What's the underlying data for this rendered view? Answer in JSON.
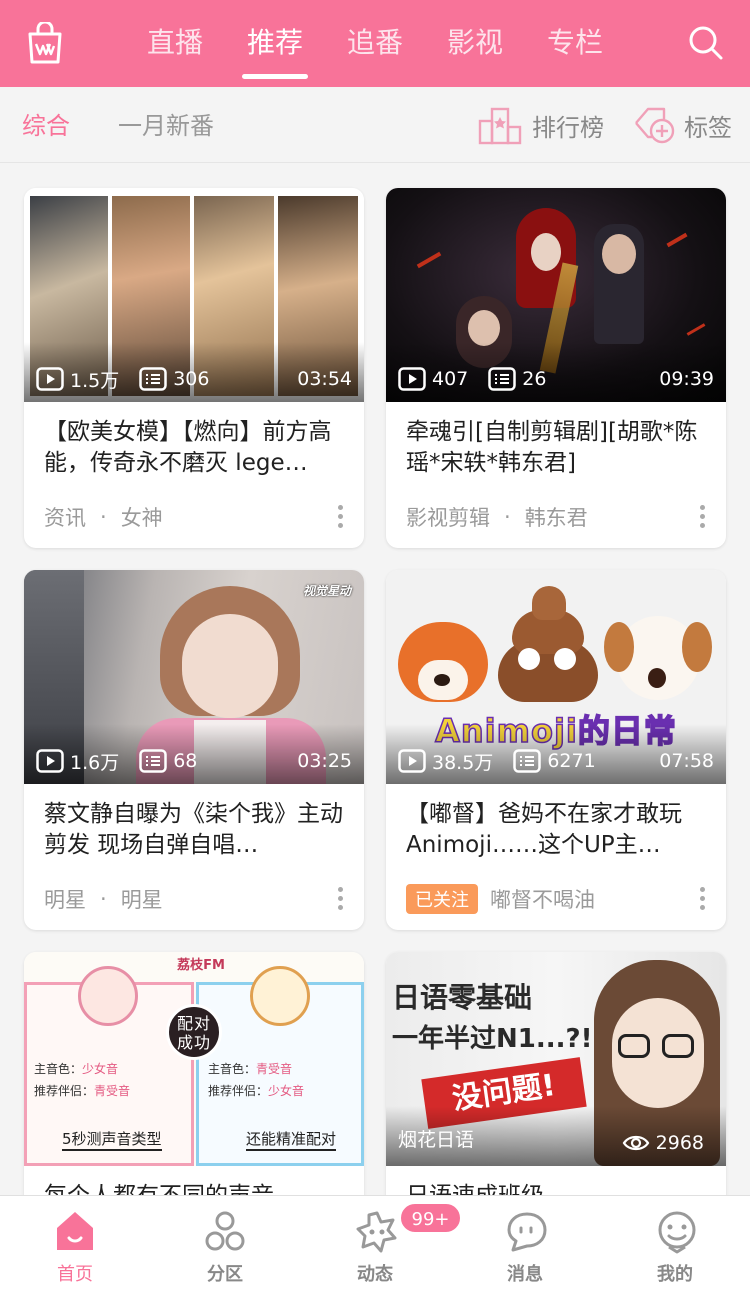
{
  "top_tabs": [
    "直播",
    "推荐",
    "追番",
    "影视",
    "专栏"
  ],
  "active_tab": "推荐",
  "sub_tabs": [
    "综合",
    "一月新番"
  ],
  "actions": {
    "ranking": "排行榜",
    "tags": "标签"
  },
  "cards": [
    {
      "plays": "1.5万",
      "danmaku": "306",
      "duration": "03:54",
      "title": "【欧美女模】【燃向】前方高能，传奇永不磨灭 lege…",
      "tag1": "资讯",
      "tag2": "女神"
    },
    {
      "plays": "407",
      "danmaku": "26",
      "duration": "09:39",
      "title": "牵魂引[自制剪辑剧][胡歌*陈瑶*宋轶*韩东君]",
      "tag1": "影视剪辑",
      "tag2": "韩东君"
    },
    {
      "plays": "1.6万",
      "danmaku": "68",
      "duration": "03:25",
      "title": "蔡文静自曝为《柒个我》主动剪发 现场自弹自唱…",
      "tag1": "明星",
      "tag2": "明星",
      "watermark": "视觉星动"
    },
    {
      "plays": "38.5万",
      "danmaku": "6271",
      "duration": "07:58",
      "title": "【嘟督】爸妈不在家才敢玩Animoji……这个UP主…",
      "followed": "已关注",
      "uploader": "嘟督不喝油",
      "thumb_text": "Animoji的日常"
    },
    {
      "title": "每个人都有不同的声音",
      "thumb": {
        "brand": "荔枝FM",
        "badge": "配对成功",
        "left_main_label": "主音色：",
        "left_main_value": "少女音",
        "left_partner_label": "推荐伴侣：",
        "left_partner_value": "青受音",
        "right_main_label": "主音色：",
        "right_main_value": "青受音",
        "right_partner_label": "推荐伴侣：",
        "right_partner_value": "少女音",
        "left_caption": "5秒测声音类型",
        "right_caption": "还能精准配对"
      }
    },
    {
      "title": "日语速成班级",
      "thumb": {
        "line1": "日语零基础",
        "line2": "一年半过N1...?!",
        "stamp": "没问题!",
        "channel": "烟花日语",
        "views": "2968"
      }
    }
  ],
  "bottom_nav": [
    "首页",
    "分区",
    "动态",
    "消息",
    "我的"
  ],
  "active_nav": "首页",
  "badge_count": "99+",
  "colors": {
    "brand_pink": "#f87399",
    "follow_orange": "#fa9a5a"
  }
}
